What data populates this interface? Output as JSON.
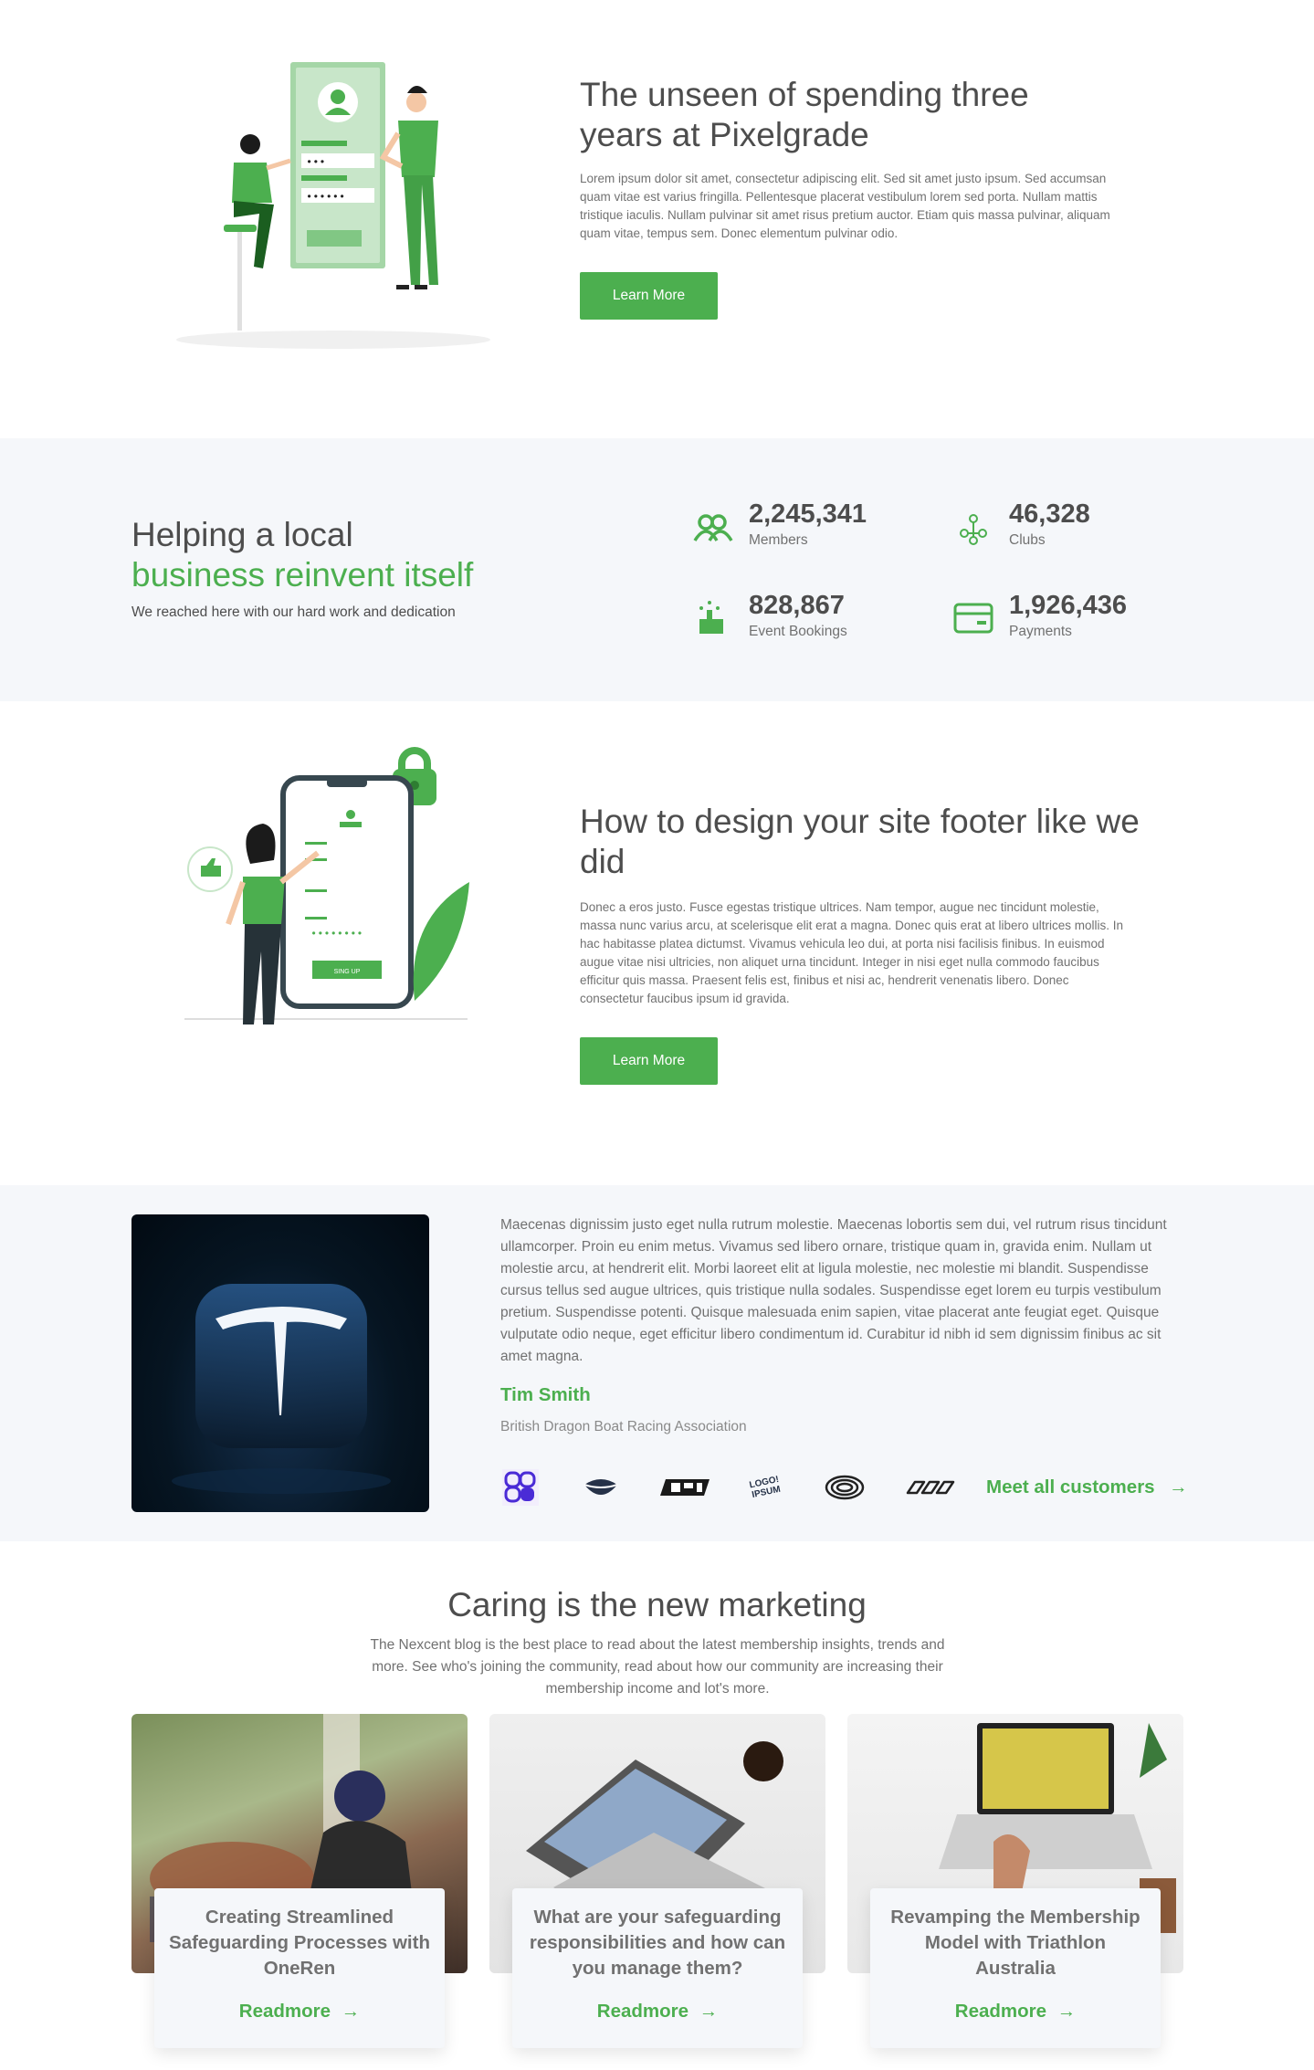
{
  "hero": {
    "title": "The unseen of spending three years at Pixelgrade",
    "body": "Lorem ipsum dolor sit amet, consectetur adipiscing elit. Sed sit amet justo ipsum. Sed accumsan quam vitae est varius fringilla. Pellentesque placerat vestibulum lorem sed porta. Nullam mattis tristique iaculis. Nullam pulvinar sit amet risus pretium auctor. Etiam quis massa pulvinar, aliquam quam vitae, tempus sem. Donec elementum pulvinar odio.",
    "button": "Learn More"
  },
  "stats": {
    "heading_line1": "Helping a local",
    "heading_line2": "business reinvent itself",
    "subtext": "We reached here with our hard work and dedication",
    "items": [
      {
        "value": "2,245,341",
        "label": "Members",
        "icon": "members-icon"
      },
      {
        "value": "46,328",
        "label": "Clubs",
        "icon": "clubs-icon"
      },
      {
        "value": "828,867",
        "label": "Event Bookings",
        "icon": "event-bookings-icon"
      },
      {
        "value": "1,926,436",
        "label": "Payments",
        "icon": "payments-icon"
      }
    ]
  },
  "footer_feature": {
    "title": "How to design your site footer like we did",
    "body": "Donec a eros justo. Fusce egestas tristique ultrices. Nam tempor, augue nec tincidunt molestie, massa nunc varius arcu, at scelerisque elit erat a magna. Donec quis erat at libero ultrices mollis. In hac habitasse platea dictumst. Vivamus vehicula leo dui, at porta nisi facilisis finibus. In euismod augue vitae nisi ultricies, non aliquet urna tincidunt. Integer in nisi eget nulla commodo faucibus efficitur quis massa. Praesent felis est, finibus et nisi ac, hendrerit venenatis libero. Donec consectetur faucibus ipsum id gravida.",
    "button": "Learn More",
    "phone_button": "SING UP"
  },
  "testimonial": {
    "quote": "Maecenas dignissim justo eget nulla rutrum molestie. Maecenas lobortis sem dui, vel rutrum risus tincidunt ullamcorper. Proin eu enim metus. Vivamus sed libero ornare, tristique quam in, gravida enim. Nullam ut molestie arcu, at hendrerit elit. Morbi laoreet elit at ligula molestie, nec molestie mi blandit. Suspendisse cursus tellus sed augue ultrices, quis tristique nulla sodales. Suspendisse eget lorem eu turpis vestibulum pretium. Suspendisse potenti. Quisque malesuada enim sapien, vitae placerat ante feugiat eget. Quisque vulputate odio neque, eget efficitur libero condimentum id. Curabitur id nibh id sem dignissim finibus ac sit amet magna.",
    "name": "Tim Smith",
    "org": "British Dragon Boat Racing Association",
    "logo_text": "LOGO! IPSUM",
    "meet_link": "Meet all customers",
    "arrow": "→"
  },
  "blog": {
    "title": "Caring is the new marketing",
    "intro": "The Nexcent blog is the best place to read about the latest membership insights, trends and more. See who's joining the community, read about how our community are increasing their membership income and lot's more.",
    "cards": [
      {
        "title": "Creating Streamlined Safeguarding Processes with OneRen",
        "link": "Readmore"
      },
      {
        "title": "What are your safeguarding responsibilities and how can you manage them?",
        "link": "Readmore"
      },
      {
        "title": "Revamping the Membership Model with Triathlon Australia",
        "link": "Readmore"
      }
    ],
    "arrow": "→"
  },
  "colors": {
    "accent": "#4caf4f",
    "text": "#4d4d4d",
    "muted": "#717171",
    "band": "#f5f7fa"
  }
}
